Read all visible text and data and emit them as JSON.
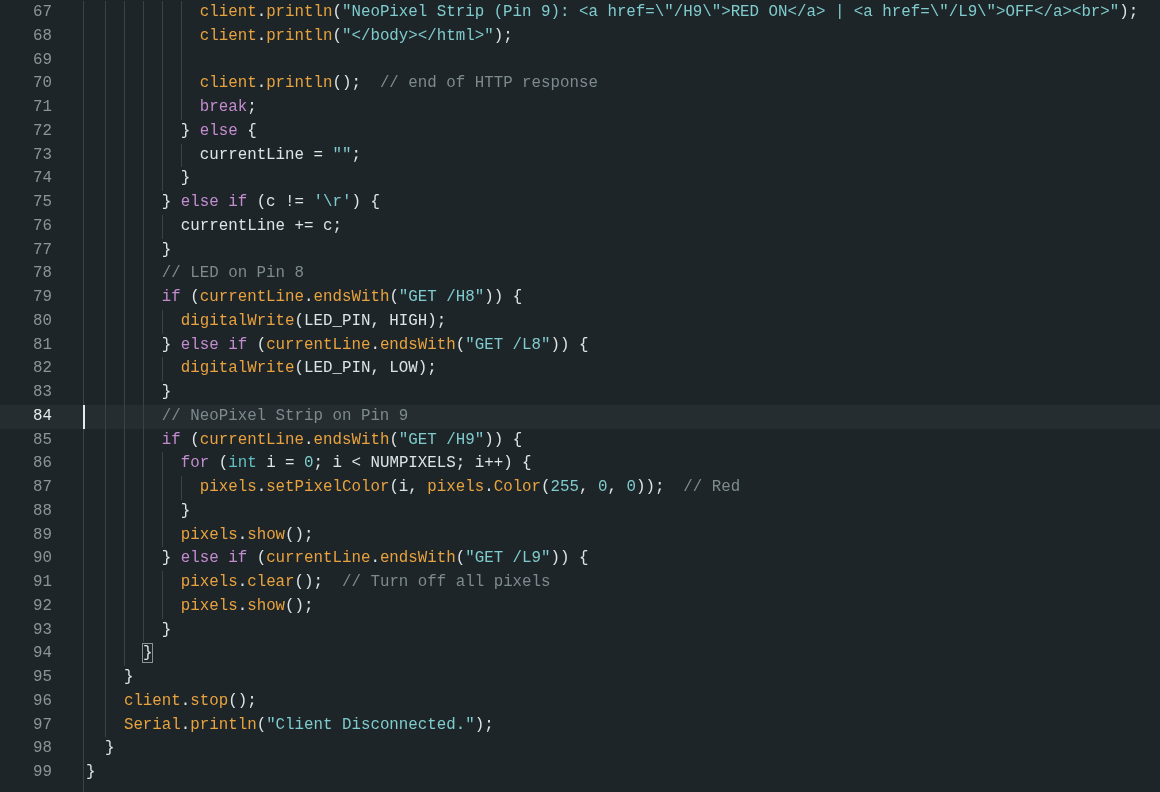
{
  "editor": {
    "lines": [
      {
        "number": "67",
        "current": false,
        "tokens": [
          {
            "text": "            client",
            "kind": "func"
          },
          {
            "text": ".",
            "kind": "plain"
          },
          {
            "text": "println",
            "kind": "func"
          },
          {
            "text": "(",
            "kind": "plain"
          },
          {
            "text": "\"NeoPixel Strip (Pin 9): <a href=\\\"/H9\\\">RED ON</a> | <a href=\\\"/L9\\\">OFF</a><br>\"",
            "kind": "string"
          },
          {
            "text": ");",
            "kind": "plain"
          }
        ]
      },
      {
        "number": "68",
        "current": false,
        "tokens": [
          {
            "text": "            client",
            "kind": "func"
          },
          {
            "text": ".",
            "kind": "plain"
          },
          {
            "text": "println",
            "kind": "func"
          },
          {
            "text": "(",
            "kind": "plain"
          },
          {
            "text": "\"</body></html>\"",
            "kind": "string"
          },
          {
            "text": ");",
            "kind": "plain"
          }
        ]
      },
      {
        "number": "69",
        "current": false
      },
      {
        "number": "70",
        "current": false,
        "tokens": [
          {
            "text": "            client",
            "kind": "func"
          },
          {
            "text": ".",
            "kind": "plain"
          },
          {
            "text": "println",
            "kind": "func"
          },
          {
            "text": "();  ",
            "kind": "plain"
          },
          {
            "text": "// end of HTTP response",
            "kind": "comment"
          }
        ]
      },
      {
        "number": "71",
        "current": false,
        "tokens": [
          {
            "text": "            break",
            "kind": "keyword"
          },
          {
            "text": ";",
            "kind": "plain"
          }
        ]
      },
      {
        "number": "72",
        "current": false,
        "tokens": [
          {
            "text": "          } ",
            "kind": "plain"
          },
          {
            "text": "else",
            "kind": "keyword"
          },
          {
            "text": " {",
            "kind": "plain"
          }
        ]
      },
      {
        "number": "73",
        "current": false,
        "tokens": [
          {
            "text": "            currentLine = ",
            "kind": "plain"
          },
          {
            "text": "\"\"",
            "kind": "string"
          },
          {
            "text": ";",
            "kind": "plain"
          }
        ]
      },
      {
        "number": "74",
        "current": false,
        "tokens": [
          {
            "text": "          }",
            "kind": "plain"
          }
        ]
      },
      {
        "number": "75",
        "current": false,
        "tokens": [
          {
            "text": "        } ",
            "kind": "plain"
          },
          {
            "text": "else if",
            "kind": "keyword"
          },
          {
            "text": " (c != ",
            "kind": "plain"
          },
          {
            "text": "'\\r'",
            "kind": "string"
          },
          {
            "text": ") {",
            "kind": "plain"
          }
        ]
      },
      {
        "number": "76",
        "current": false,
        "tokens": [
          {
            "text": "          currentLine += c;",
            "kind": "plain"
          }
        ]
      },
      {
        "number": "77",
        "current": false,
        "tokens": [
          {
            "text": "        }",
            "kind": "plain"
          }
        ]
      },
      {
        "number": "78",
        "current": false,
        "tokens": [
          {
            "text": "        // LED on Pin 8",
            "kind": "comment"
          }
        ]
      },
      {
        "number": "79",
        "current": false,
        "tokens": [
          {
            "text": "        if",
            "kind": "keyword"
          },
          {
            "text": " (",
            "kind": "plain"
          },
          {
            "text": "currentLine",
            "kind": "func"
          },
          {
            "text": ".",
            "kind": "plain"
          },
          {
            "text": "endsWith",
            "kind": "func"
          },
          {
            "text": "(",
            "kind": "plain"
          },
          {
            "text": "\"GET /H8\"",
            "kind": "string"
          },
          {
            "text": ")) {",
            "kind": "plain"
          }
        ]
      },
      {
        "number": "80",
        "current": false,
        "tokens": [
          {
            "text": "          digitalWrite",
            "kind": "func"
          },
          {
            "text": "(LED_PIN, HIGH);",
            "kind": "plain"
          }
        ]
      },
      {
        "number": "81",
        "current": false,
        "tokens": [
          {
            "text": "        } ",
            "kind": "plain"
          },
          {
            "text": "else if",
            "kind": "keyword"
          },
          {
            "text": " (",
            "kind": "plain"
          },
          {
            "text": "currentLine",
            "kind": "func"
          },
          {
            "text": ".",
            "kind": "plain"
          },
          {
            "text": "endsWith",
            "kind": "func"
          },
          {
            "text": "(",
            "kind": "plain"
          },
          {
            "text": "\"GET /L8\"",
            "kind": "string"
          },
          {
            "text": ")) {",
            "kind": "plain"
          }
        ]
      },
      {
        "number": "82",
        "current": false,
        "tokens": [
          {
            "text": "          digitalWrite",
            "kind": "func"
          },
          {
            "text": "(LED_PIN, LOW);",
            "kind": "plain"
          }
        ]
      },
      {
        "number": "83",
        "current": false,
        "tokens": [
          {
            "text": "        }",
            "kind": "plain"
          }
        ]
      },
      {
        "number": "84",
        "current": true,
        "tokens": [
          {
            "text": "        // NeoPixel Strip on Pin 9",
            "kind": "comment"
          }
        ]
      },
      {
        "number": "85",
        "current": false,
        "tokens": [
          {
            "text": "        if",
            "kind": "keyword"
          },
          {
            "text": " (",
            "kind": "plain"
          },
          {
            "text": "currentLine",
            "kind": "func"
          },
          {
            "text": ".",
            "kind": "plain"
          },
          {
            "text": "endsWith",
            "kind": "func"
          },
          {
            "text": "(",
            "kind": "plain"
          },
          {
            "text": "\"GET /H9\"",
            "kind": "string"
          },
          {
            "text": ")) {",
            "kind": "plain"
          }
        ]
      },
      {
        "number": "86",
        "current": false,
        "tokens": [
          {
            "text": "          for",
            "kind": "keyword"
          },
          {
            "text": " (",
            "kind": "plain"
          },
          {
            "text": "int",
            "kind": "type"
          },
          {
            "text": " i = ",
            "kind": "plain"
          },
          {
            "text": "0",
            "kind": "number"
          },
          {
            "text": "; i < NUMPIXELS; i++) {",
            "kind": "plain"
          }
        ]
      },
      {
        "number": "87",
        "current": false,
        "tokens": [
          {
            "text": "            pixels",
            "kind": "func"
          },
          {
            "text": ".",
            "kind": "plain"
          },
          {
            "text": "setPixelColor",
            "kind": "func"
          },
          {
            "text": "(i, ",
            "kind": "plain"
          },
          {
            "text": "pixels",
            "kind": "func"
          },
          {
            "text": ".",
            "kind": "plain"
          },
          {
            "text": "Color",
            "kind": "func"
          },
          {
            "text": "(",
            "kind": "plain"
          },
          {
            "text": "255",
            "kind": "number"
          },
          {
            "text": ", ",
            "kind": "plain"
          },
          {
            "text": "0",
            "kind": "number"
          },
          {
            "text": ", ",
            "kind": "plain"
          },
          {
            "text": "0",
            "kind": "number"
          },
          {
            "text": "));  ",
            "kind": "plain"
          },
          {
            "text": "// Red",
            "kind": "comment"
          }
        ]
      },
      {
        "number": "88",
        "current": false,
        "tokens": [
          {
            "text": "          }",
            "kind": "plain"
          }
        ]
      },
      {
        "number": "89",
        "current": false,
        "tokens": [
          {
            "text": "          pixels",
            "kind": "func"
          },
          {
            "text": ".",
            "kind": "plain"
          },
          {
            "text": "show",
            "kind": "func"
          },
          {
            "text": "();",
            "kind": "plain"
          }
        ]
      },
      {
        "number": "90",
        "current": false,
        "tokens": [
          {
            "text": "        } ",
            "kind": "plain"
          },
          {
            "text": "else if",
            "kind": "keyword"
          },
          {
            "text": " (",
            "kind": "plain"
          },
          {
            "text": "currentLine",
            "kind": "func"
          },
          {
            "text": ".",
            "kind": "plain"
          },
          {
            "text": "endsWith",
            "kind": "func"
          },
          {
            "text": "(",
            "kind": "plain"
          },
          {
            "text": "\"GET /L9\"",
            "kind": "string"
          },
          {
            "text": ")) {",
            "kind": "plain"
          }
        ]
      },
      {
        "number": "91",
        "current": false,
        "tokens": [
          {
            "text": "          pixels",
            "kind": "func"
          },
          {
            "text": ".",
            "kind": "plain"
          },
          {
            "text": "clear",
            "kind": "func"
          },
          {
            "text": "();  ",
            "kind": "plain"
          },
          {
            "text": "// Turn off all pixels",
            "kind": "comment"
          }
        ]
      },
      {
        "number": "92",
        "current": false,
        "tokens": [
          {
            "text": "          pixels",
            "kind": "func"
          },
          {
            "text": ".",
            "kind": "plain"
          },
          {
            "text": "show",
            "kind": "func"
          },
          {
            "text": "();",
            "kind": "plain"
          }
        ]
      },
      {
        "number": "93",
        "current": false,
        "tokens": [
          {
            "text": "        }",
            "kind": "plain"
          }
        ]
      },
      {
        "number": "94",
        "current": false,
        "tokens": [
          {
            "text": "      }",
            "kind": "bracket"
          }
        ]
      },
      {
        "number": "95",
        "current": false,
        "tokens": [
          {
            "text": "    }",
            "kind": "plain"
          }
        ]
      },
      {
        "number": "96",
        "current": false,
        "tokens": [
          {
            "text": "    client",
            "kind": "func"
          },
          {
            "text": ".",
            "kind": "plain"
          },
          {
            "text": "stop",
            "kind": "func"
          },
          {
            "text": "();",
            "kind": "plain"
          }
        ]
      },
      {
        "number": "97",
        "current": false,
        "tokens": [
          {
            "text": "    Serial",
            "kind": "func"
          },
          {
            "text": ".",
            "kind": "plain"
          },
          {
            "text": "println",
            "kind": "func"
          },
          {
            "text": "(",
            "kind": "plain"
          },
          {
            "text": "\"Client Disconnected.\"",
            "kind": "string"
          },
          {
            "text": ");",
            "kind": "plain"
          }
        ]
      },
      {
        "number": "98",
        "current": false,
        "tokens": [
          {
            "text": "  }",
            "kind": "plain"
          }
        ]
      },
      {
        "number": "99",
        "current": false,
        "tokens": [
          {
            "text": "}",
            "kind": "plain"
          }
        ]
      }
    ]
  }
}
